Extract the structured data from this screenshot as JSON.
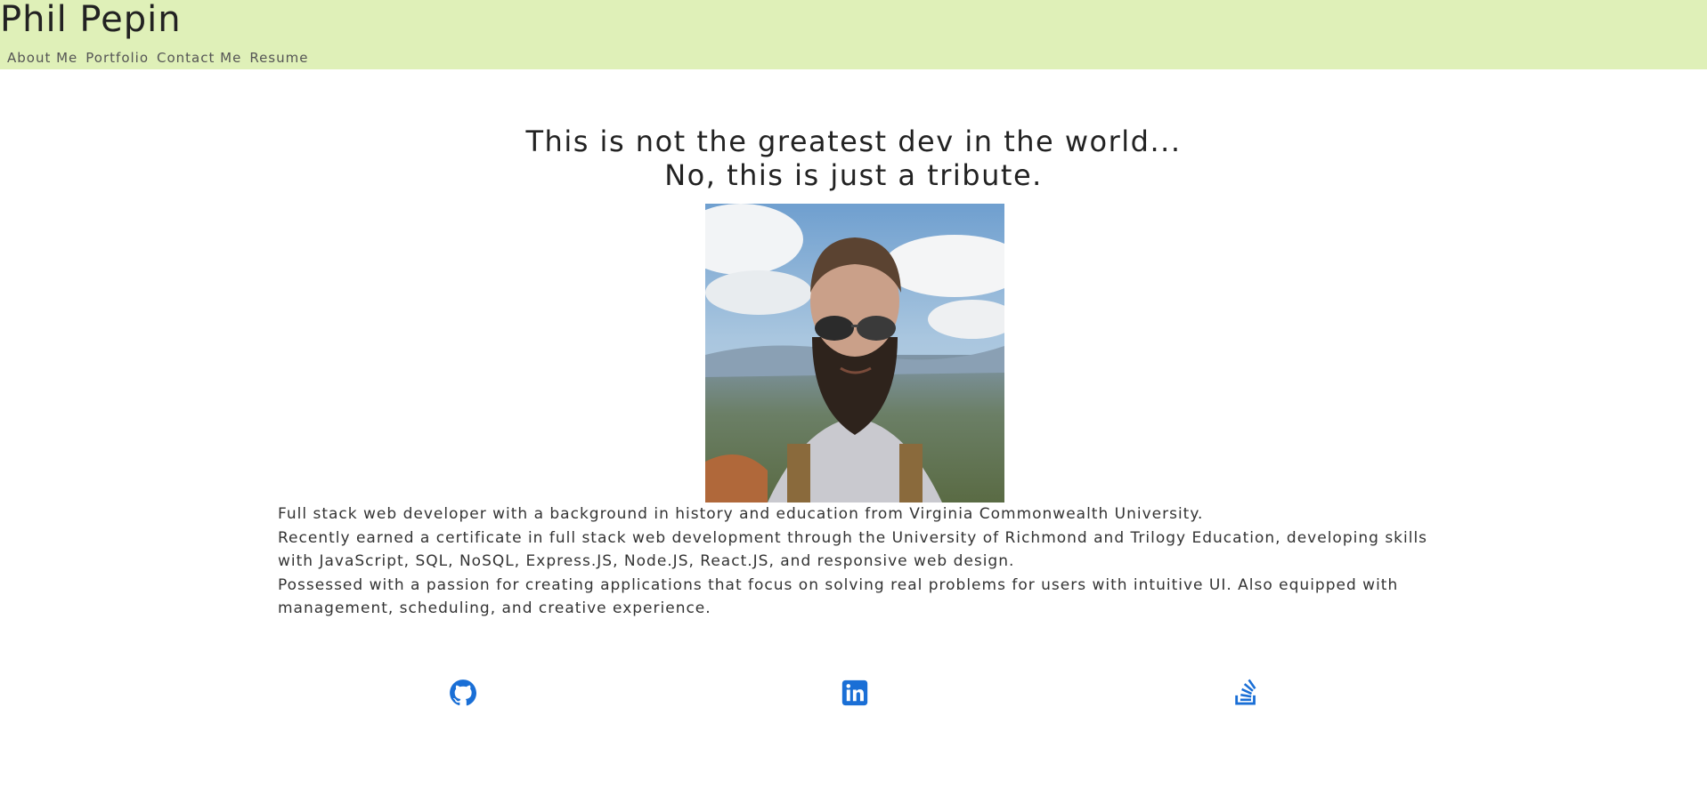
{
  "header": {
    "title": "Phil Pepin",
    "nav": [
      "About Me",
      "Portfolio",
      "Contact Me",
      "Resume"
    ]
  },
  "hero": {
    "line1": "This is not the greatest dev in the world...",
    "line2": "No, this is just a tribute."
  },
  "bio": {
    "p1": "Full stack web developer with a background in history and education from Virginia Commonwealth University.",
    "p2": "Recently earned a certificate in full stack web development through the University of Richmond and Trilogy Education, developing skills with JavaScript, SQL, NoSQL, Express.JS, Node.JS, React.JS, and responsive web design.",
    "p3": "Possessed with a passion for creating applications that focus on solving real problems for users with intuitive UI. Also equipped with management, scheduling, and creative experience."
  },
  "socials": [
    {
      "icon": "github-icon"
    },
    {
      "icon": "linkedin-icon"
    },
    {
      "icon": "stackoverflow-icon"
    }
  ],
  "colors": {
    "header_bg": "#dff0b8",
    "icon_blue": "#1a6fd6"
  }
}
